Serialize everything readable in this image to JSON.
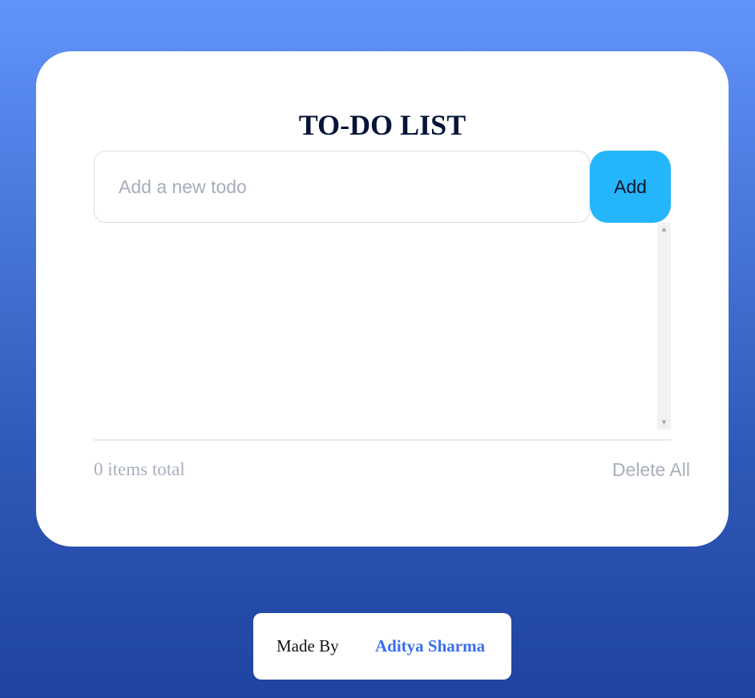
{
  "app": {
    "title": "TO-DO LIST"
  },
  "todo_form": {
    "input_value": "",
    "input_placeholder": "Add a new todo",
    "add_button_label": "Add"
  },
  "todo_list": {
    "items": []
  },
  "footer": {
    "items_total_text": "0 items total",
    "delete_all_label": "Delete All"
  },
  "credits": {
    "made_by_label": "Made By",
    "author_name": "Aditya Sharma"
  },
  "icons": {
    "scroll_up": "scroll-up-arrow-icon",
    "scroll_down": "scroll-down-arrow-icon"
  },
  "colors": {
    "background_gradient_top": "#6194fb",
    "background_gradient_bottom": "#1f43a0",
    "card_background": "#ffffff",
    "title": "#061438",
    "add_button": "#25b5fb",
    "muted_text": "#a8afbc",
    "author_link": "#3b6ef0"
  }
}
